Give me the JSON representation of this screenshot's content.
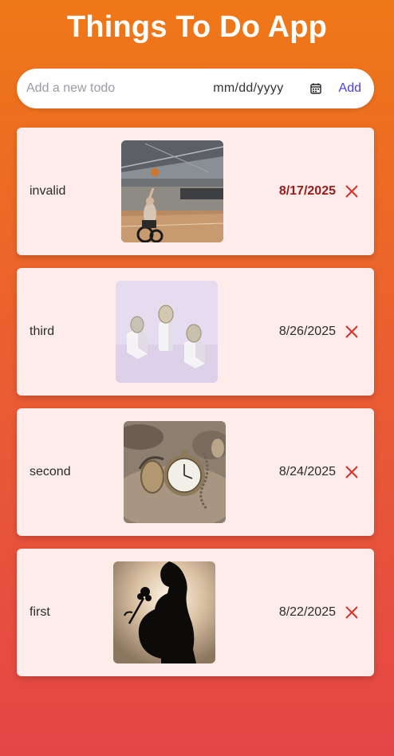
{
  "app": {
    "title": "Things To Do App"
  },
  "add_form": {
    "placeholder": "Add a new todo",
    "date_placeholder": "mm/dd/yyyy",
    "add_label": "Add",
    "calendar_icon": "calendar-icon"
  },
  "todos": [
    {
      "text": "invalid",
      "date": "8/17/2025",
      "overdue": true,
      "image": "wheelchair-basketball-photo",
      "delete_icon": "close-icon"
    },
    {
      "text": "third",
      "date": "8/26/2025",
      "overdue": false,
      "image": "coins-on-pedestals-photo",
      "delete_icon": "close-icon"
    },
    {
      "text": "second",
      "date": "8/24/2025",
      "overdue": false,
      "image": "pocket-watch-in-sand-photo",
      "delete_icon": "close-icon"
    },
    {
      "text": "first",
      "date": "8/22/2025",
      "overdue": false,
      "image": "silhouette-with-flower-photo",
      "delete_icon": "close-icon"
    }
  ],
  "colors": {
    "background_top": "#ef7817",
    "background_bottom": "#e44646",
    "card_background": "#fdecea",
    "accent": "#4b3fd6",
    "delete": "#d9302c",
    "overdue_date": "#9a1b1b"
  }
}
